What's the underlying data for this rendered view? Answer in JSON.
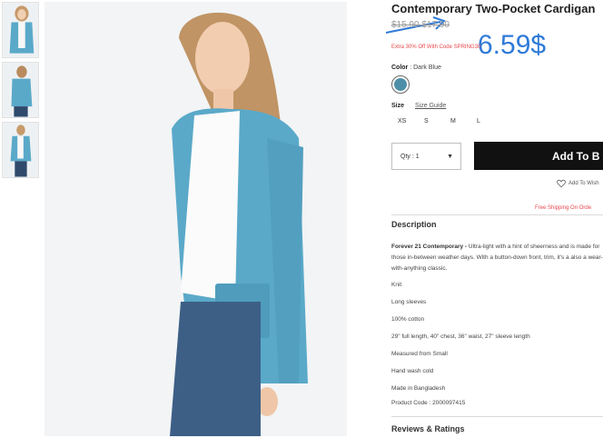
{
  "product": {
    "title": "Contemporary Two-Pocket Cardigan",
    "old_price": "$15.90 $17.90",
    "promo": "Extra 30% Off With Code SPRING30",
    "color_label": "Color",
    "color_value": "Dark Blue",
    "swatch_color": "#4d8fa8",
    "size_label": "Size",
    "size_guide": "Size Guide",
    "sizes": [
      "XS",
      "S",
      "M",
      "L"
    ],
    "qty_text": "Qty : 1",
    "add_button": "Add To B",
    "wishlist": "Add To Wish",
    "shipping": "Free Shipping On Orde",
    "description_title": "Description",
    "description_brand": "Forever 21 Contemporary -",
    "description_text": "Ultra-light with a hint of sheerness and is made for those in-between weather days. With a button-down front, trim, it's a also a wear-with-anything classic.",
    "specs": [
      "Knit",
      "Long sleeves",
      "100% cotton",
      "29\" full length, 40\" chest, 36\" waist, 27\" sleeve length",
      "Measured from Small",
      "Hand wash cold",
      "Made in Bangladesh",
      "Product Code : 2000097415"
    ],
    "reviews_title": "Reviews & Ratings"
  },
  "annotation": {
    "price": "6.59$",
    "color": "#2f7ad8"
  },
  "icons": {
    "qty_dropdown": "caret-down-icon",
    "wishlist": "heart-outline-icon",
    "annotation_arrow": "arrow-right-icon"
  }
}
